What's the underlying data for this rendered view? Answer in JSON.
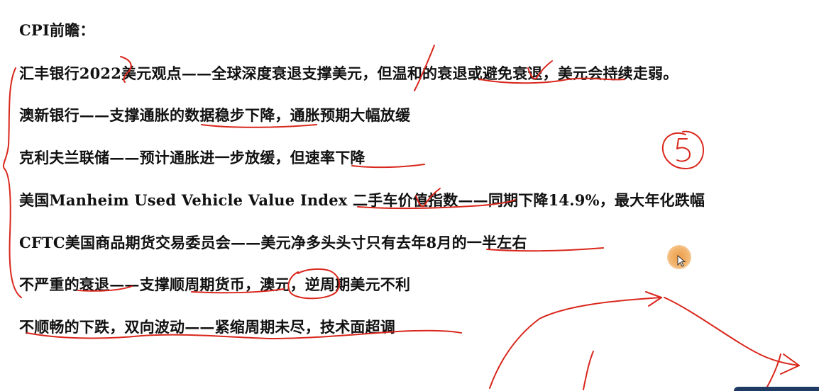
{
  "heading": "CPI前瞻：",
  "lines": [
    "汇丰银行2022美元观点——全球深度衰退支撑美元，但温和的衰退或避免衰退，美元会持续走弱。",
    "澳新银行——支撑通胀的数据稳步下降，通胀预期大幅放缓",
    "克利夫兰联储——预计通胀进一步放缓，但速率下降",
    "美国Manheim Used Vehicle Value Index 二手车价值指数——同期下降14.9%，最大年化跌幅",
    "CFTC美国商品期货交易委员会——美元净多头头寸只有去年8月的一半左右",
    "不严重的衰退——支撑顺周期货币，澳元，逆周期美元不利",
    "不顺畅的下跌，双向波动——紧缩周期未尽，技术面超调"
  ],
  "annotation": {
    "circled_mark": "5",
    "ink_color": "#d9271c"
  },
  "cursor": {
    "highlight_color": "#ec963c"
  }
}
